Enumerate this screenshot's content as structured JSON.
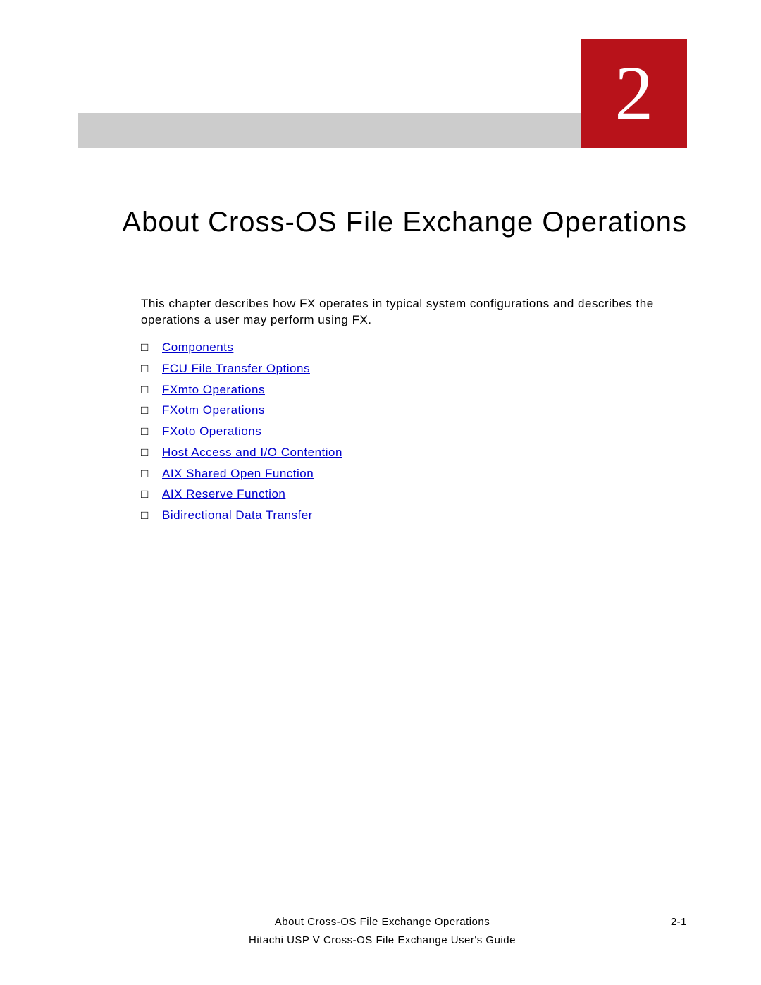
{
  "chapter_number": "2",
  "title": "About Cross-OS File Exchange Operations",
  "intro": "This chapter describes how FX operates in typical system configurations and describes the operations a user may perform using FX.",
  "toc": [
    "Components",
    "FCU File Transfer Options",
    "FXmto Operations",
    "FXotm Operations",
    "FXoto Operations",
    "Host Access and I/O Contention",
    "AIX Shared Open Function",
    "AIX Reserve Function",
    "Bidirectional Data Transfer"
  ],
  "footer": {
    "section": "About Cross-OS File Exchange Operations",
    "page": "2-1",
    "book": "Hitachi USP V Cross-OS File Exchange User's Guide"
  }
}
